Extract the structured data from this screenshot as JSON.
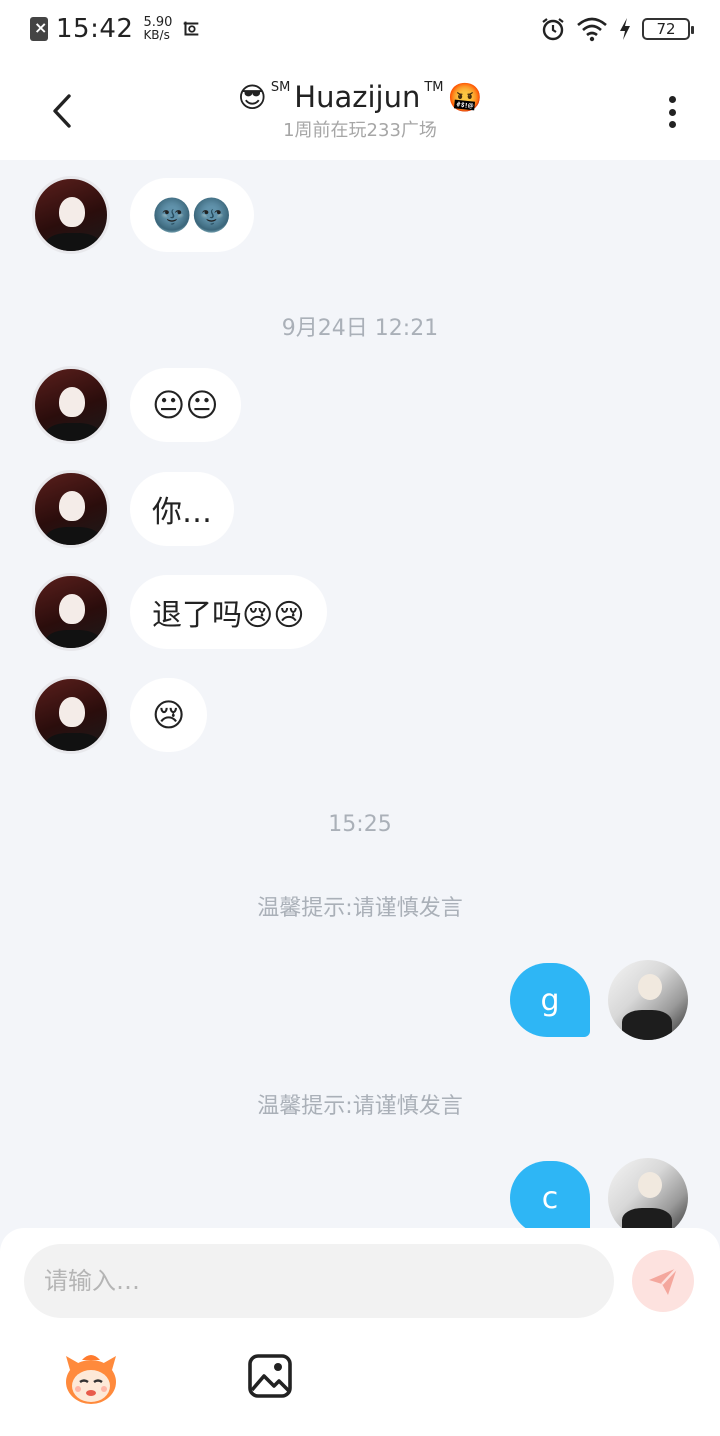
{
  "status_bar": {
    "time": "15:42",
    "net_speed_value": "5.90",
    "net_speed_unit": "KB/s",
    "battery": "72"
  },
  "header": {
    "title_emoji_left": "😎",
    "title_sup_left": "SM",
    "title_name": "Huazijun",
    "title_sup_right": "TM",
    "title_emoji_right": "🤬",
    "subtitle": "1周前在玩233广场"
  },
  "messages": [
    {
      "side": "left",
      "text": "🌚🌚"
    },
    {
      "side": "left",
      "text": "😐😐"
    },
    {
      "side": "left",
      "text": "你…"
    },
    {
      "side": "left",
      "text": "退了吗😢😢"
    },
    {
      "side": "left",
      "text": "😢"
    },
    {
      "side": "right",
      "text": "g"
    },
    {
      "side": "right",
      "text": "c"
    }
  ],
  "timestamps": [
    "9月24日 12:21",
    "15:25"
  ],
  "tips": [
    "温馨提示:请谨慎发言",
    "温馨提示:请谨慎发言"
  ],
  "input": {
    "placeholder": "请输入…"
  },
  "icons": {
    "back": "chevron-left-icon",
    "more": "more-vertical-icon",
    "send": "paper-plane-icon",
    "emoji": "mascot-emoji-icon",
    "image": "image-icon"
  },
  "colors": {
    "accent_blue": "#2eb6f5",
    "send_bg": "#fde2df",
    "send_fg": "#f4a79d",
    "background": "#f3f5f9"
  }
}
